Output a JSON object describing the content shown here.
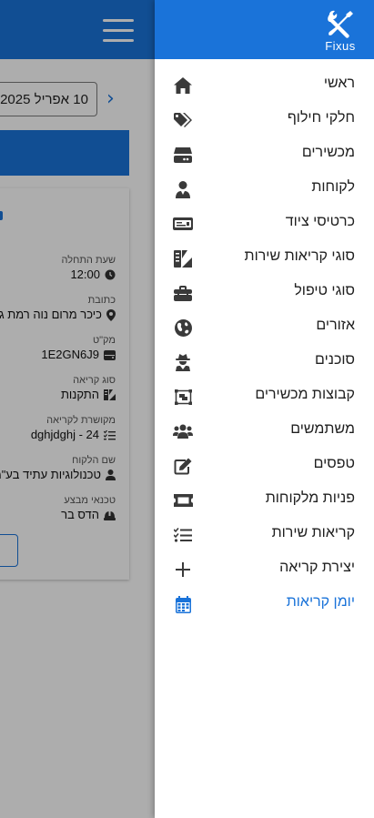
{
  "colors": {
    "primary": "#1a73d9",
    "icon": "#3a3a3a",
    "text": "#1f1f1f",
    "active": "#1a73d9"
  },
  "app": {
    "logo_text": "Fixus",
    "logo_icon": "wrench-screwdriver-icon"
  },
  "background": {
    "date_value": "10 אפריל 2025",
    "next_icon": "chevron-right-icon",
    "card_fields": [
      {
        "label": "שעת התחלה",
        "value": "12:00",
        "icon": "clock-icon"
      },
      {
        "label": "כתובת",
        "value": "כיכר מרום נוה רמת גן",
        "icon": "location-icon"
      },
      {
        "label": "מק\"ט",
        "value": "1E2GN6J9",
        "icon": "device-icon"
      },
      {
        "label": "סוג קריאה",
        "value": "התקנות",
        "icon": "call-type-icon"
      },
      {
        "label": "מקושרת לקריאה",
        "value": "24 - dghjdghj",
        "icon": "list-check-icon"
      },
      {
        "label": "שם הלקוח",
        "value": "טכנולוגיות עתיד בע\"מ",
        "icon": "user-icon"
      },
      {
        "label": "טכנאי מבצע",
        "value": "הדס בר",
        "icon": "hat-icon"
      }
    ]
  },
  "menu": [
    {
      "label": "ראשי",
      "icon": "home-icon"
    },
    {
      "label": "חלקי חילוף",
      "icon": "tags-icon"
    },
    {
      "label": "מכשירים",
      "icon": "hdd-icon"
    },
    {
      "label": "לקוחות",
      "icon": "user-tie-icon"
    },
    {
      "label": "כרטיסי ציוד",
      "icon": "card-icon"
    },
    {
      "label": "סוגי קריאות שירות",
      "icon": "call-types-icon"
    },
    {
      "label": "סוגי טיפול",
      "icon": "toolbox-icon"
    },
    {
      "label": "אזורים",
      "icon": "globe-icon"
    },
    {
      "label": "סוכנים",
      "icon": "agent-icon"
    },
    {
      "label": "קבוצות מכשירים",
      "icon": "object-group-icon"
    },
    {
      "label": "משתמשים",
      "icon": "users-icon"
    },
    {
      "label": "טפסים",
      "icon": "edit-icon"
    },
    {
      "label": "פניות מלקוחות",
      "icon": "ticket-icon"
    },
    {
      "label": "קריאות שירות",
      "icon": "tasks-icon"
    },
    {
      "label": "יצירת קריאה",
      "icon": "plus-icon"
    },
    {
      "label": "יומן קריאות",
      "icon": "calendar-icon",
      "active": true
    }
  ]
}
